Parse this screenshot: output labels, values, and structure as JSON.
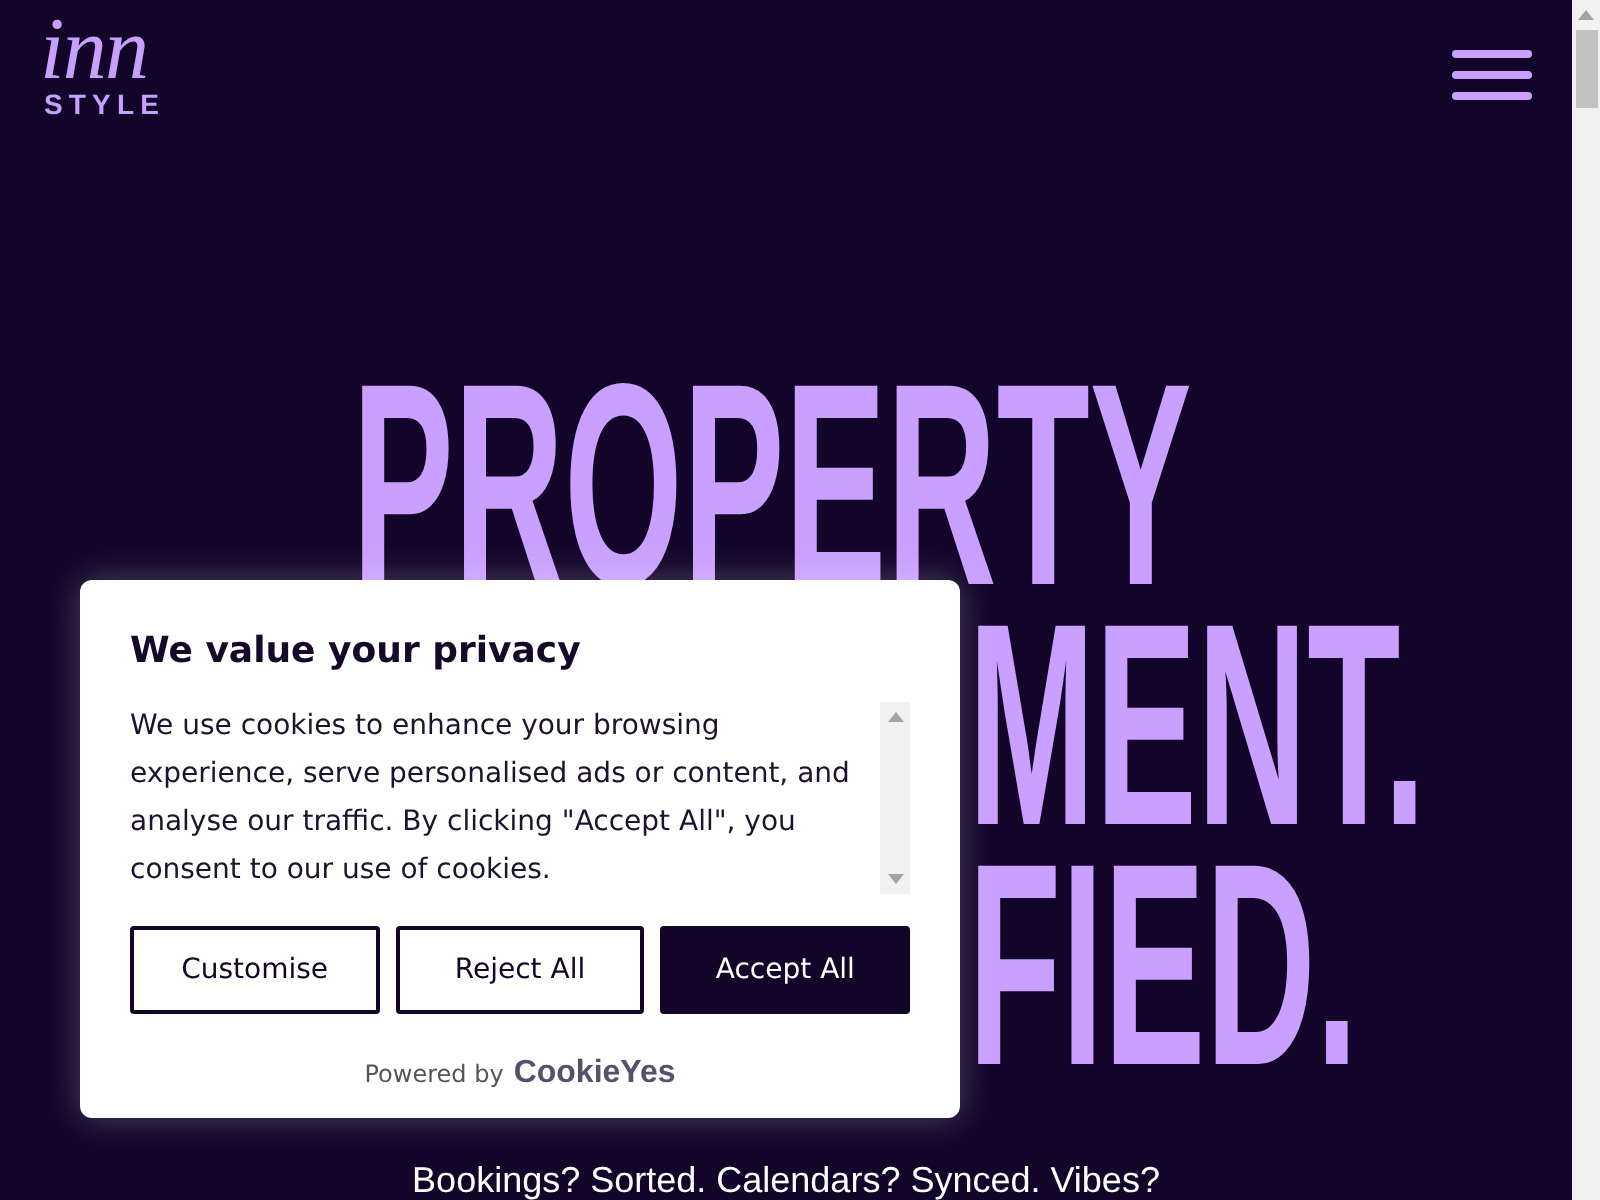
{
  "header": {
    "logo": {
      "script": "inn",
      "wordmark": "STYLE"
    }
  },
  "hero": {
    "lines": [
      "PROPERTY",
      "MENT.",
      "FIED."
    ],
    "tagline": "Bookings? Sorted. Calendars? Synced. Vibes?"
  },
  "cookie_banner": {
    "title": "We value your privacy",
    "message": "We use cookies to enhance your browsing experience, serve personalised ads or content, and analyse our traffic. By clicking \"Accept All\", you consent to our use of cookies.",
    "buttons": [
      {
        "label": "Customise",
        "kind": "outline"
      },
      {
        "label": "Reject All",
        "kind": "outline"
      },
      {
        "label": "Accept All",
        "kind": "filled"
      }
    ],
    "footer": {
      "prefix": "Powered by",
      "brand": "CookieYes"
    }
  }
}
